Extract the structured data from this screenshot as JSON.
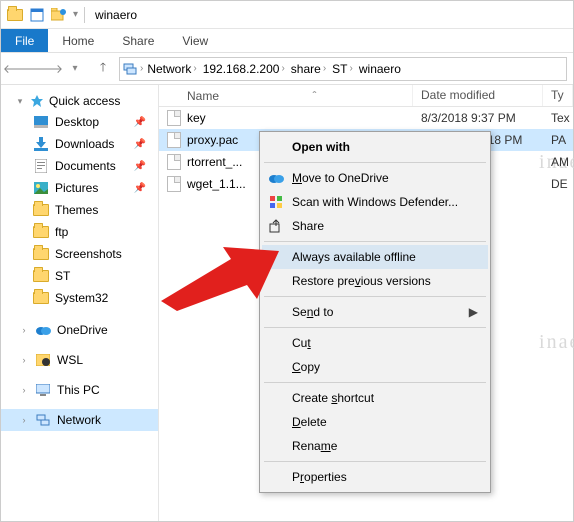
{
  "window": {
    "title": "winaero"
  },
  "ribbon": {
    "file": "File",
    "home": "Home",
    "share": "Share",
    "view": "View"
  },
  "breadcrumbs": [
    "Network",
    "192.168.2.200",
    "share",
    "ST",
    "winaero"
  ],
  "sidebar": {
    "quickAccess": "Quick access",
    "items": [
      {
        "label": "Desktop",
        "pinned": true,
        "icon": "desktop"
      },
      {
        "label": "Downloads",
        "pinned": true,
        "icon": "downloads"
      },
      {
        "label": "Documents",
        "pinned": true,
        "icon": "documents"
      },
      {
        "label": "Pictures",
        "pinned": true,
        "icon": "pictures"
      },
      {
        "label": "Themes",
        "pinned": false,
        "icon": "folder"
      },
      {
        "label": "ftp",
        "pinned": false,
        "icon": "folder"
      },
      {
        "label": "Screenshots",
        "pinned": false,
        "icon": "folder"
      },
      {
        "label": "ST",
        "pinned": false,
        "icon": "folder"
      },
      {
        "label": "System32",
        "pinned": false,
        "icon": "folder"
      }
    ],
    "onedrive": "OneDrive",
    "wsl": "WSL",
    "thispc": "This PC",
    "network": "Network"
  },
  "columns": {
    "name": "Name",
    "date": "Date modified",
    "type": "Ty"
  },
  "files": [
    {
      "name": "key",
      "date": "8/3/2018 9:37 PM",
      "type": "Tex"
    },
    {
      "name": "proxy.pac",
      "date": "6/29/2018 1:18 PM",
      "type": "PA",
      "selected": true
    },
    {
      "name": "rtorrent_...",
      "date": "",
      "type": "AM"
    },
    {
      "name": "wget_1.1...",
      "date": "",
      "type": "DE"
    }
  ],
  "contextmenu": {
    "openwith": "Open with",
    "onedrive": "Move to OneDrive",
    "defender": "Scan with Windows Defender...",
    "share": "Share",
    "offline": "Always available offline",
    "restore": "Restore previous versions",
    "sendto": "Send to",
    "cut": "Cut",
    "copy": "Copy",
    "shortcut": "Create shortcut",
    "delete": "Delete",
    "rename": "Rename",
    "properties": "Properties"
  }
}
